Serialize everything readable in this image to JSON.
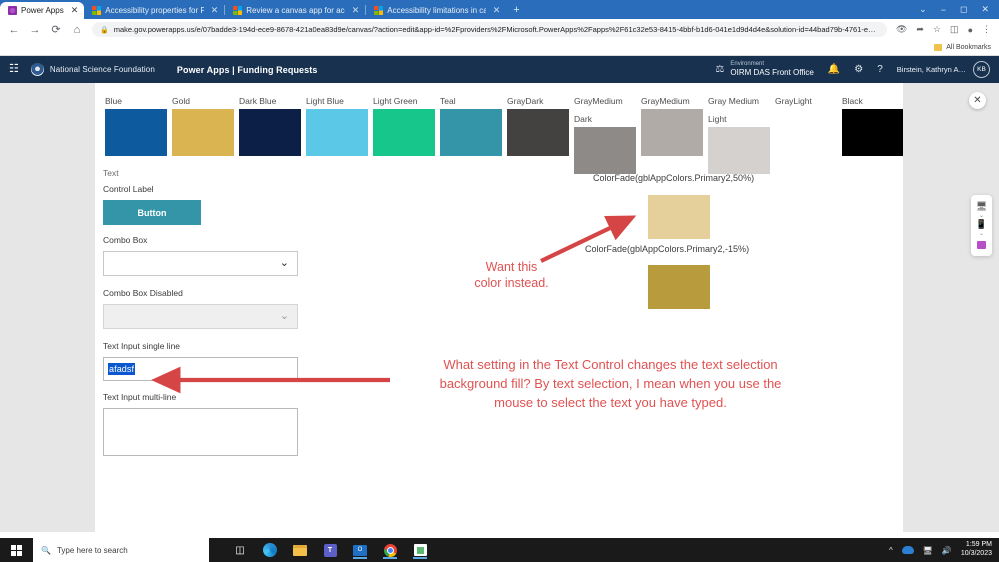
{
  "browser": {
    "tabs": [
      {
        "title": "Power Apps",
        "favicon": "powerapps-icon",
        "active": true
      },
      {
        "title": "Accessibility properties for Pow",
        "favicon": "microsoft-icon",
        "active": false
      },
      {
        "title": "Review a canvas app for accessi",
        "favicon": "microsoft-icon",
        "active": false
      },
      {
        "title": "Accessibility limitations in canv",
        "favicon": "microsoft-icon",
        "active": false
      }
    ],
    "tab_close_glyph": "✕",
    "new_tab_glyph": "+",
    "window_controls": {
      "minimize": "⌄",
      "restore": "−",
      "maximize": "◻",
      "close": "✕"
    },
    "nav": {
      "back": "←",
      "forward": "→",
      "reload": "⟳",
      "home": "⌂"
    },
    "omnibox": {
      "lock_glyph": "🔒",
      "url": "make.gov.powerapps.us/e/07badde3-194d-ece9-8678-421a0ea83d9e/canvas/?action=edit&app-id=%2Fproviders%2FMicrosoft.PowerApps%2Fapps%2F61c32e53-8415-4bbf-b1d6-041e1d9d4d4e&solution-id=44bad79b-4761-ee11-be6e-001dd80…"
    },
    "toolbar_icons": [
      "eye-slash-icon",
      "share-icon",
      "star-icon",
      "sidepanel-icon",
      "profile-icon",
      "kebab-menu-icon"
    ],
    "bookmarks_bar": {
      "label": "All Bookmarks"
    }
  },
  "app_header": {
    "waffle": "waffle-icon",
    "org_name": "National Science Foundation",
    "title": "Power Apps  |  Funding Requests",
    "environment": {
      "label": "Environment",
      "value": "OIRM DAS Front Office"
    },
    "icons": [
      "bell-icon",
      "gear-icon",
      "help-icon"
    ],
    "user": {
      "name": "Birstein, Kathryn A…",
      "initials": "KB"
    }
  },
  "canvas": {
    "close_glyph": "✕",
    "device_rail": {
      "monitor_icon": "monitor-icon",
      "phone_icon": "phone-icon",
      "app_icon": "app-icon",
      "chevron": "⌄"
    },
    "swatches": [
      {
        "label": "Blue",
        "color": "#0d5b9e"
      },
      {
        "label": "Gold",
        "color": "#d9b451"
      },
      {
        "label": "Dark Blue",
        "color": "#0c1f46"
      },
      {
        "label": "Light Blue",
        "color": "#5cc8e8"
      },
      {
        "label": "Light Green",
        "color": "#16c68b"
      },
      {
        "label": "Teal",
        "color": "#3494a8"
      },
      {
        "label": "GrayDark",
        "color": "#444240"
      },
      {
        "label": "GrayMedium Dark",
        "color": "#8d8a88"
      },
      {
        "label": "GrayMedium",
        "color": "#b1aba7"
      },
      {
        "label": "Gray Medium Light",
        "color": "#d4d1ce"
      },
      {
        "label": "GrayLight",
        "color": "#ffffff"
      },
      {
        "label": "Black",
        "color": "#000000"
      }
    ],
    "controls": {
      "text_label": "Text",
      "control_label": "Control Label",
      "button_label": "Button",
      "combo_box_label": "Combo Box",
      "combo_box_disabled_label": "Combo Box Disabled",
      "chevron_glyph": "⌄",
      "text_input_single_label": "Text Input single line",
      "text_input_single_value": "afadsf",
      "text_input_multi_label": "Text Input multi-line",
      "text_input_multi_value": "",
      "button_color": "#3494a8",
      "selection_fill": "#0b57d0"
    },
    "annotations": {
      "colorfade_50_label": "ColorFade(gblAppColors.Primary2,50%)",
      "colorfade_50_color": "#e5d09b",
      "colorfade_neg15_label": "ColorFade(gblAppColors.Primary2,-15%)",
      "colorfade_neg15_color": "#b89b3d",
      "want_this_line1": "Want this",
      "want_this_line2": "color instead.",
      "question": "What setting in the Text Control changes the text selection background fill? By text selection, I mean when you use the mouse to select the text you have typed.",
      "annotation_color": "#e05252"
    }
  },
  "taskbar": {
    "start_icon": "windows-start-icon",
    "search_placeholder": "Type here to search",
    "search_icon": "search-icon",
    "pinned": [
      "task-view-icon",
      "edge-icon",
      "file-explorer-icon",
      "teams-icon",
      "outlook-icon",
      "chrome-icon",
      "snipping-tool-icon"
    ],
    "tray": {
      "chevron": "^",
      "onedrive_icon": "onedrive-icon",
      "network_icon": "network-icon",
      "volume_icon": "volume-icon"
    },
    "time": "1:59 PM",
    "date": "10/3/2023"
  }
}
